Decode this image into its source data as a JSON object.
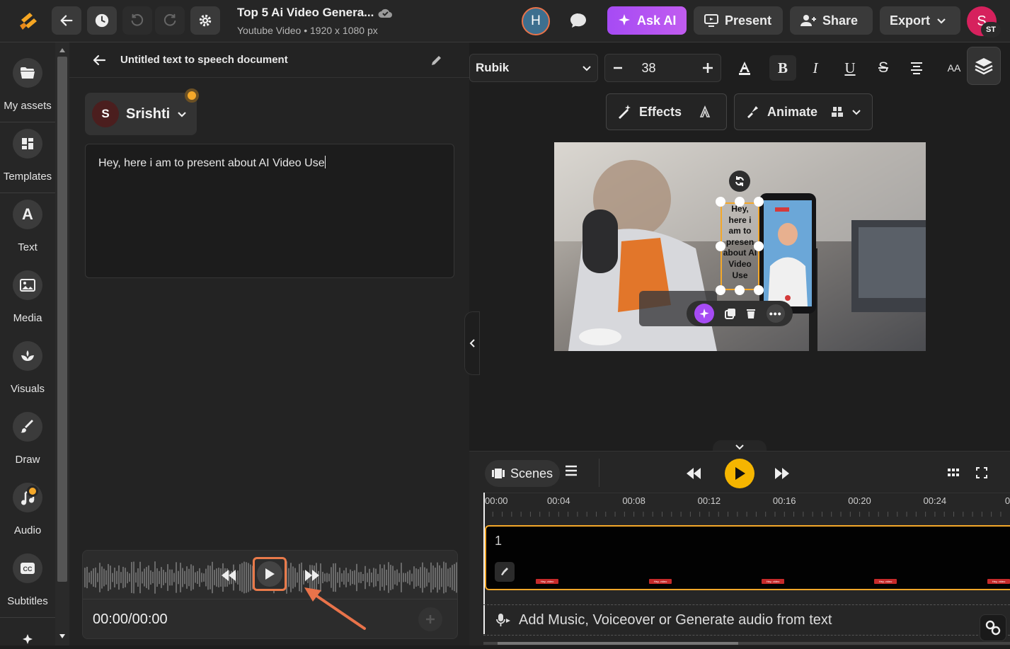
{
  "topbar": {
    "title": "Top 5 Ai Video Genera...",
    "subtitle": "Youtube Video • 1920 x 1080 px",
    "collab_initial": "H",
    "ask_ai": "Ask AI",
    "present": "Present",
    "share": "Share",
    "export": "Export",
    "user_initial": "S",
    "user_badge": "ST"
  },
  "leftnav": {
    "items": [
      {
        "label": "My assets",
        "icon": "folder-icon"
      },
      {
        "label": "Templates",
        "icon": "templates-icon"
      },
      {
        "label": "Text",
        "icon": "text-icon"
      },
      {
        "label": "Media",
        "icon": "image-icon"
      },
      {
        "label": "Visuals",
        "icon": "visuals-icon"
      },
      {
        "label": "Draw",
        "icon": "brush-icon"
      },
      {
        "label": "Audio",
        "icon": "music-icon"
      },
      {
        "label": "Subtitles",
        "icon": "cc-icon"
      }
    ]
  },
  "panel": {
    "title": "Untitled text to speech document",
    "voice_initial": "S",
    "voice_name": "Srishti",
    "text": "Hey, here i am to present about AI Video Use",
    "time": "00:00/00:00"
  },
  "toolbar": {
    "font": "Rubik",
    "size": "38",
    "bold": "B",
    "italic": "I",
    "underline": "U",
    "strike": "S",
    "case": "AA"
  },
  "actions": {
    "effects": "Effects",
    "animate": "Animate"
  },
  "canvas": {
    "overlay_text": "Hey, here i am to presen about AI Video Use"
  },
  "timeline": {
    "scenes": "Scenes",
    "ticks": [
      "00:00",
      "00:04",
      "00:08",
      "00:12",
      "00:16",
      "00:20",
      "00:24",
      "00"
    ],
    "scene_number": "1",
    "mini_label": "Hey, video",
    "add_audio": "Add Music, Voiceover or Generate audio from text"
  },
  "colors": {
    "accent": "#f5b500",
    "ask_ai": "#b356f3",
    "highlight": "#e97a4a",
    "selection": "#f4a82a"
  }
}
